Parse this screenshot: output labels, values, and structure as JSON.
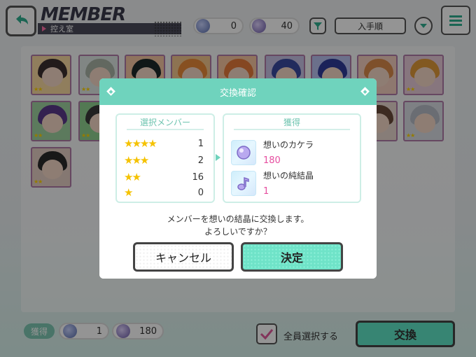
{
  "header": {
    "title": "MEMBER",
    "subtitle": "控え室",
    "currency_memory_piece": "0",
    "currency_crystal": "40",
    "sort_label": "入手順"
  },
  "footer": {
    "gain_label": "獲得",
    "gain_memory_piece": "1",
    "gain_crystal": "180",
    "select_all_label": "全員選択する",
    "exchange_label": "交換"
  },
  "modal": {
    "title": "交換確認",
    "members_panel_title": "選択メンバー",
    "rarity_rows": [
      {
        "stars": "★★★★",
        "count": "1"
      },
      {
        "stars": "★★★",
        "count": "2"
      },
      {
        "stars": "★★",
        "count": "16"
      },
      {
        "stars": "★",
        "count": "0"
      }
    ],
    "gain_panel_title": "獲得",
    "items": [
      {
        "name": "想いのカケラ",
        "count": "180"
      },
      {
        "name": "想いの純結晶",
        "count": "1"
      }
    ],
    "message_line1": "メンバーを想いの結晶に交換します。",
    "message_line2": "よろしいですか？",
    "cancel_label": "キャンセル",
    "confirm_label": "決定"
  },
  "colors": {
    "accent": "#6fd3bd",
    "count_pink": "#e64fa0",
    "star_gold": "#f5c200"
  }
}
